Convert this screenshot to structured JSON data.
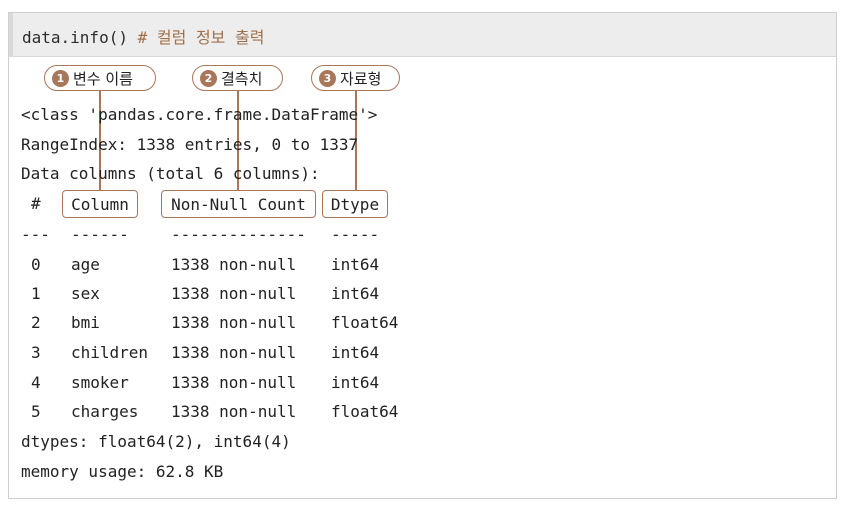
{
  "header": {
    "code": "data.info()",
    "comment": "# 컬럼 정보 출력"
  },
  "labels": [
    {
      "num": "1",
      "text": "변수 이름"
    },
    {
      "num": "2",
      "text": "결측치"
    },
    {
      "num": "3",
      "text": "자료형"
    }
  ],
  "output": {
    "class_line": "<class 'pandas.core.frame.DataFrame'>",
    "range_line": "RangeIndex: 1338 entries, 0 to 1337",
    "columns_line": "Data columns (total 6 columns):",
    "header_hash": "#",
    "header_column": "Column",
    "header_nonnull": "Non-Null Count",
    "header_dtype": "Dtype",
    "sep_hash": "---",
    "sep_column": "------",
    "sep_nonnull": "--------------",
    "sep_dtype": "-----",
    "rows": [
      {
        "idx": "0",
        "column": "age",
        "count": "1338 non-null",
        "dtype": "int64"
      },
      {
        "idx": "1",
        "column": "sex",
        "count": "1338 non-null",
        "dtype": "int64"
      },
      {
        "idx": "2",
        "column": "bmi",
        "count": "1338 non-null",
        "dtype": "float64"
      },
      {
        "idx": "3",
        "column": "children",
        "count": "1338 non-null",
        "dtype": "int64"
      },
      {
        "idx": "4",
        "column": "smoker",
        "count": "1338 non-null",
        "dtype": "int64"
      },
      {
        "idx": "5",
        "column": "charges",
        "count": "1338 non-null",
        "dtype": "float64"
      }
    ],
    "dtypes_line": "dtypes: float64(2), int64(4)",
    "memory_line": "memory usage: 62.8 KB"
  },
  "colors": {
    "accent": "#a8775a",
    "header_bg": "#ededed",
    "comment": "#a0704a"
  }
}
